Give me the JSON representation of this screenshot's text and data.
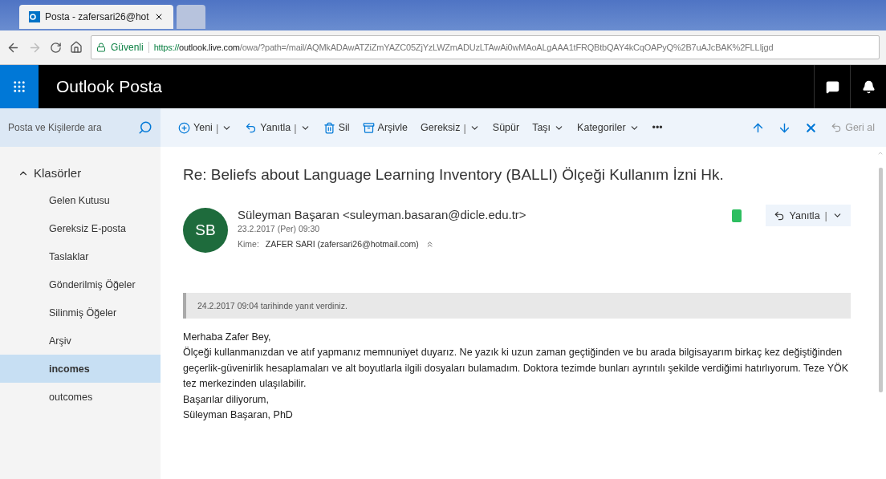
{
  "browser": {
    "tabs": [
      {
        "title": "Posta - zafersari26@hot",
        "selected": true
      },
      {
        "selected": false
      }
    ],
    "security": "Güvenli",
    "url_scheme": "https://",
    "url_host": "outlook.live.com",
    "url_path": "/owa/?path=/mail/AQMkADAwATZiZmYAZC05ZjYzLWZmADUzLTAwAi0wMAoALgAAA1tFRQBtbQAY4kCqOAPyQ%2B7uAJcBAK%2FLLIjgd"
  },
  "header": {
    "app_title": "Outlook Posta"
  },
  "search": {
    "placeholder": "Posta ve Kişilerde ara"
  },
  "toolbar": [
    {
      "label": "Yeni",
      "kind": "new",
      "separator": "|",
      "menu": true
    },
    {
      "label": "Yanıtla",
      "kind": "reply",
      "separator": "|",
      "menu": true
    },
    {
      "label": "Sil",
      "kind": "delete",
      "menu": false
    },
    {
      "label": "Arşivle",
      "kind": "archive",
      "menu": false
    },
    {
      "label": "Gereksiz",
      "kind": "text",
      "separator": "|",
      "menu": true
    },
    {
      "label": "Süpür",
      "kind": "text",
      "menu": false
    },
    {
      "label": "Taşı",
      "kind": "text",
      "menu": true
    },
    {
      "label": "Kategoriler",
      "kind": "text",
      "menu": true
    },
    {
      "label": "•••",
      "kind": "text",
      "menu": false
    }
  ],
  "undo": {
    "label": "Geri al",
    "disabled": true
  },
  "sidebar": {
    "heading": "Klasörler",
    "expanded": true,
    "items": [
      {
        "label": "Gelen Kutusu",
        "selected": false
      },
      {
        "label": "Gereksiz E-posta",
        "selected": false
      },
      {
        "label": "Taslaklar",
        "selected": false
      },
      {
        "label": "Gönderilmiş Öğeler",
        "selected": false
      },
      {
        "label": "Silinmiş Öğeler",
        "selected": false
      },
      {
        "label": "Arşiv",
        "selected": false
      },
      {
        "label": "incomes",
        "selected": true
      },
      {
        "label": "outcomes",
        "selected": false
      }
    ]
  },
  "message": {
    "subject": "Re: Beliefs about Language Learning Inventory (BALLI) Ölçeği Kullanım İzni Hk.",
    "avatar": "SB",
    "sender": "Süleyman Başaran <suleyman.basaran@dicle.edu.tr>",
    "date": "23.2.2017 (Per) 09:30",
    "to_label": "Kime:",
    "to": "ZAFER SARI (zafersari26@hotmail.com)",
    "reply_button": "Yanıtla",
    "reply_separator": "|",
    "notice": "24.2.2017 09:04 tarihinde yanıt verdiniz.",
    "body": [
      "Merhaba Zafer Bey,",
      "Ölçeği kullanmanızdan ve atıf yapmanız memnuniyet duyarız. Ne yazık ki uzun zaman geçtiğinden ve bu arada bilgisayarım birkaç kez değiştiğinden geçerlik-güvenirlik hesaplamaları ve alt boyutlarla ilgili dosyaları bulamadım. Doktora tezimde bunları ayrıntılı şekilde verdiğimi hatırlıyorum. Teze YÖK tez merkezinden ulaşılabilir.",
      "Başarılar diliyorum,",
      "Süleyman Başaran, PhD"
    ]
  }
}
